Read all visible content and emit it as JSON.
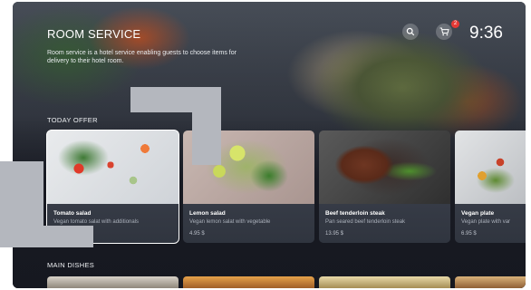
{
  "header": {
    "title": "ROOM SERVICE",
    "description": "Room service is a hotel service enabling guests to choose items for delivery to their hotel room."
  },
  "controls": {
    "search_icon": "search-icon",
    "cart_icon": "cart-icon",
    "cart_count": "2",
    "time": "9:36"
  },
  "sections": {
    "offer_title": "TODAY OFFER",
    "main_title": "MAIN DISHES"
  },
  "offers": [
    {
      "name": "Tomato salad",
      "subtitle": "Vegan tomato salat with additionals",
      "price": ""
    },
    {
      "name": "Lemon salad",
      "subtitle": "Vegan lemon salat with vegetable",
      "price": "4.95 $"
    },
    {
      "name": "Beef tenderloin steak",
      "subtitle": "Pan seared beef tenderloin steak",
      "price": "13.95 $"
    },
    {
      "name": "Vegan plate",
      "subtitle": "Vegan plate with var",
      "price": "6.95 $"
    }
  ],
  "colors": {
    "badge": "#e53935",
    "card_bg": "#30353f",
    "selected_outline": "#ffffff"
  }
}
